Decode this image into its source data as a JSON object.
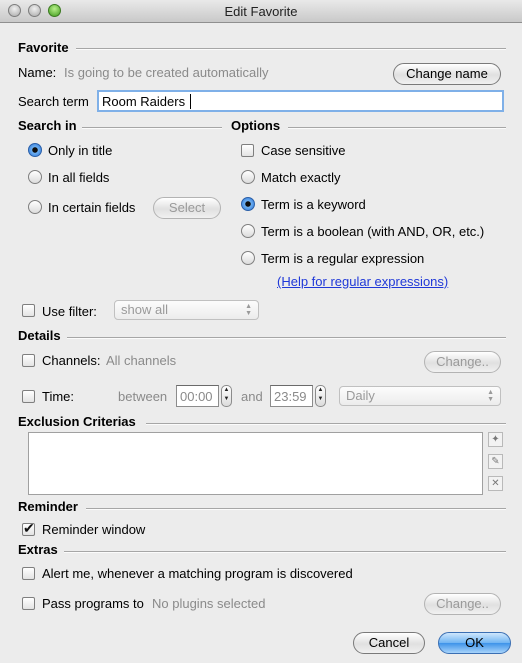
{
  "window": {
    "title": "Edit Favorite"
  },
  "favorite": {
    "heading": "Favorite",
    "name_label": "Name:",
    "name_value": "Is going to be created automatically",
    "change_name_button": "Change name",
    "search_term_label": "Search term",
    "search_term_value": "Room Raiders"
  },
  "search_in": {
    "heading": "Search in",
    "options": [
      "Only in title",
      "In all fields",
      "In certain fields"
    ],
    "selected": "Only in title",
    "select_button": "Select"
  },
  "options": {
    "heading": "Options",
    "case_sensitive": "Case sensitive",
    "radios": [
      "Match exactly",
      "Term is a keyword",
      "Term is a boolean (with AND, OR, etc.)",
      "Term is a regular expression"
    ],
    "selected": "Term is a keyword",
    "help_link": "(Help for regular expressions)"
  },
  "filter": {
    "label": "Use filter:",
    "value": "show all",
    "checked": false
  },
  "details": {
    "heading": "Details",
    "channels_label": "Channels:",
    "channels_value": "All channels",
    "change_button": "Change..",
    "time_label": "Time:",
    "between_label": "between",
    "from_time": "00:00",
    "and_label": "and",
    "to_time": "23:59",
    "frequency": "Daily"
  },
  "exclusion": {
    "heading": "Exclusion Criterias"
  },
  "reminder": {
    "heading": "Reminder",
    "window_label": "Reminder window",
    "checked": true
  },
  "extras": {
    "heading": "Extras",
    "alert_label": "Alert me, whenever a matching program is discovered",
    "pass_label": "Pass programs to",
    "plugins_value": "No plugins selected",
    "change_button": "Change.."
  },
  "footer": {
    "cancel_button": "Cancel",
    "ok_button": "OK"
  }
}
